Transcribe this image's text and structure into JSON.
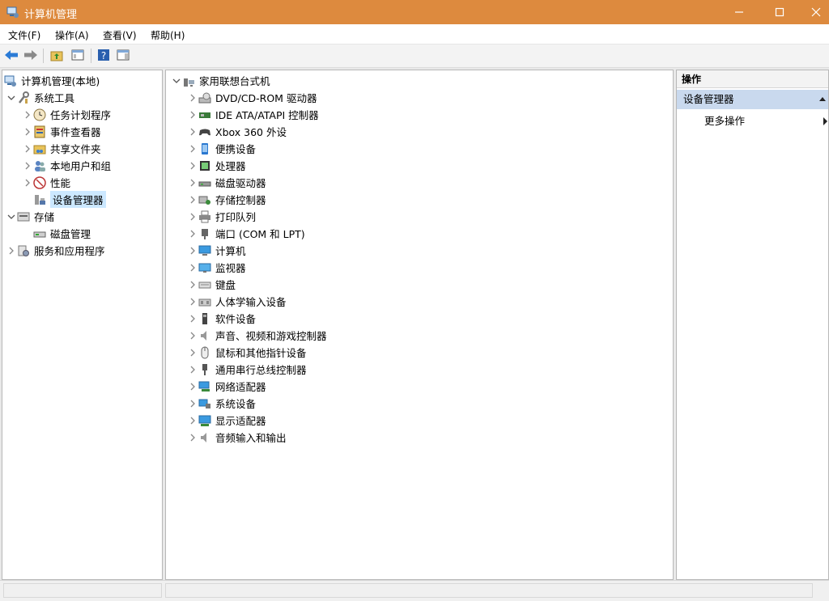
{
  "window": {
    "title": "计算机管理",
    "accent_color": "#dd8a3e"
  },
  "menu": [
    "文件(F)",
    "操作(A)",
    "查看(V)",
    "帮助(H)"
  ],
  "left_tree": {
    "root": "计算机管理(本地)",
    "system_tools": "系统工具",
    "task_scheduler": "任务计划程序",
    "event_viewer": "事件查看器",
    "shared_folders": "共享文件夹",
    "local_users": "本地用户和组",
    "performance": "性能",
    "device_manager": "设备管理器",
    "storage": "存储",
    "disk_management": "磁盘管理",
    "services": "服务和应用程序"
  },
  "device_tree": {
    "root": "家用联想台式机",
    "categories": [
      "DVD/CD-ROM 驱动器",
      "IDE ATA/ATAPI 控制器",
      "Xbox 360 外设",
      "便携设备",
      "处理器",
      "磁盘驱动器",
      "存储控制器",
      "打印队列",
      "端口 (COM 和 LPT)",
      "计算机",
      "监视器",
      "键盘",
      "人体学输入设备",
      "软件设备",
      "声音、视频和游戏控制器",
      "鼠标和其他指针设备",
      "通用串行总线控制器",
      "网络适配器",
      "系统设备",
      "显示适配器",
      "音频输入和输出"
    ]
  },
  "actions": {
    "header": "操作",
    "section": "设备管理器",
    "more": "更多操作"
  }
}
